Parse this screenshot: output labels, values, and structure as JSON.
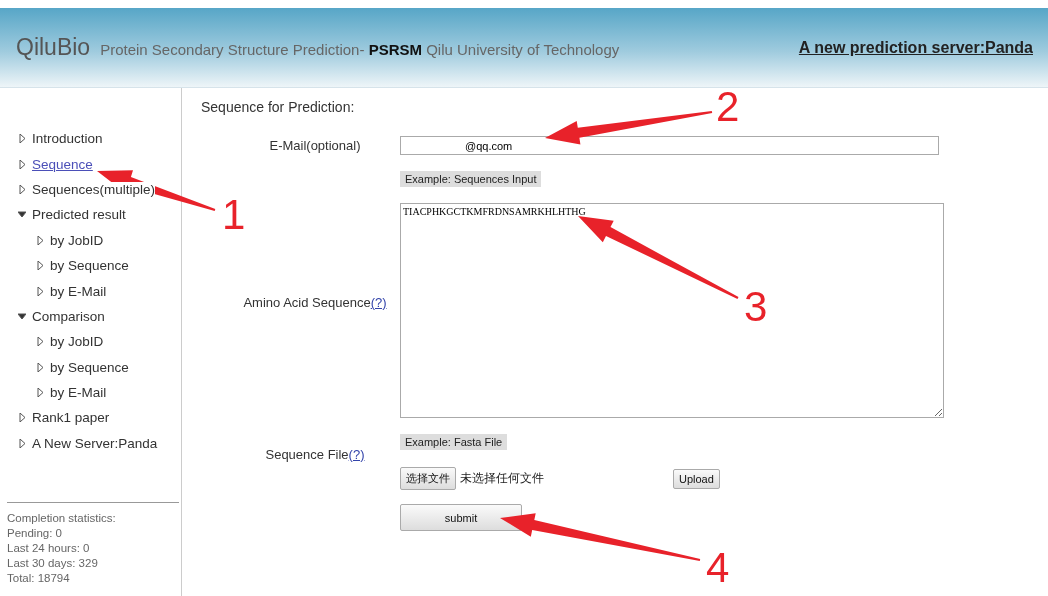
{
  "header": {
    "logo": "QiluBio",
    "subtitle": "Protein Secondary Structure Prediction- **PSRSM**  Qilu University of Technology",
    "link": "A new prediction server:Panda"
  },
  "sidebar": {
    "items": [
      {
        "label": "Introduction",
        "selected": false
      },
      {
        "label": "Sequence",
        "selected": true
      },
      {
        "label": "Sequences(multiple)",
        "selected": false
      },
      {
        "label": "Predicted result",
        "selected": false,
        "expanded": true,
        "children": [
          {
            "label": "by JobID",
            "selected": false
          },
          {
            "label": "by Sequence",
            "selected": false
          },
          {
            "label": "by E-Mail",
            "selected": false
          }
        ]
      },
      {
        "label": "Comparison",
        "selected": false,
        "expanded": true,
        "children": [
          {
            "label": "by JobID",
            "selected": false
          },
          {
            "label": "by Sequence",
            "selected": false
          },
          {
            "label": "by E-Mail",
            "selected": false
          }
        ]
      },
      {
        "label": "Rank1 paper",
        "selected": false
      },
      {
        "label": "A New Server:Panda",
        "selected": false
      }
    ],
    "stats": [
      "Completion statistics:",
      "Pending:  0",
      "Last 24 hours:  0",
      "Last 30 days:  329",
      "Total:  18794"
    ]
  },
  "form": {
    "title": "Sequence for Prediction:",
    "email": {
      "label": "E-Mail(optional)",
      "value": "@qq.com"
    },
    "example_sequence": "Example: Sequences Input",
    "sequence": {
      "label": "Amino Acid Sequence",
      "help": "(?)",
      "value": "TIACPHKGCTKMFRDNSAMRKHLHTHG"
    },
    "example_fasta": "Example: Fasta File",
    "file": {
      "label": "Sequence File",
      "help": "(?)",
      "choose": "选择文件",
      "status": "未选择任何文件",
      "upload": "Upload"
    },
    "submit": "submit"
  },
  "annotations": [
    {
      "label": "1"
    },
    {
      "label": "2"
    },
    {
      "label": "3"
    },
    {
      "label": "4"
    }
  ]
}
